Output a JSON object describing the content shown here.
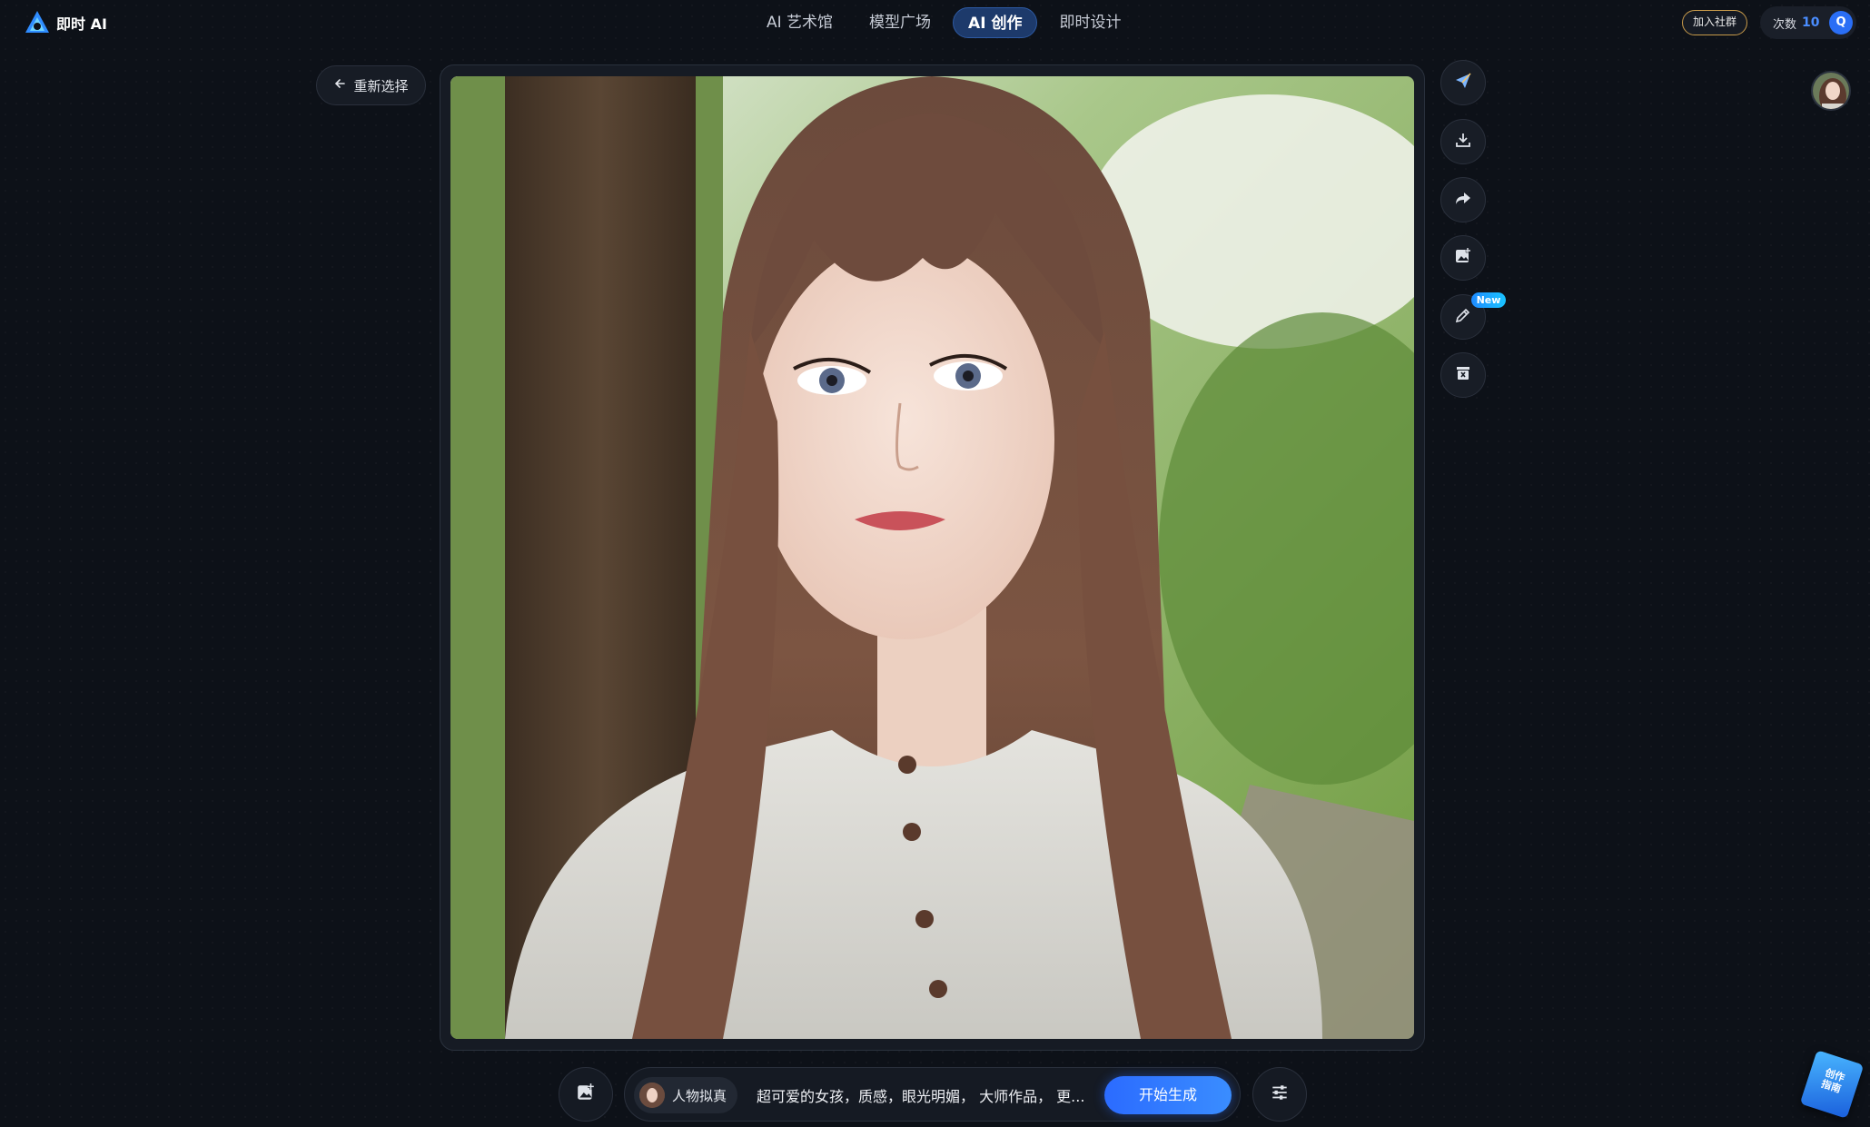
{
  "app": {
    "name": "即时 AI"
  },
  "nav": {
    "items": [
      {
        "label": "AI 艺术馆"
      },
      {
        "label": "模型广场"
      },
      {
        "label": "AI 创作"
      },
      {
        "label": "即时设计"
      }
    ],
    "active_index": 2
  },
  "header": {
    "join_label": "加入社群",
    "credits_label": "次数",
    "credits_value": "10",
    "user_initial": "Q"
  },
  "back_label": "重新选择",
  "toolbar": {
    "icons": [
      "send-icon",
      "download-icon",
      "share-icon",
      "add-image-icon",
      "edit-icon",
      "delete-icon"
    ],
    "new_badge": "New"
  },
  "prompt": {
    "style_label": "人物拟真",
    "text": "超可爱的女孩，质感，眼光明媚， 大师作品， 更...",
    "generate_label": "开始生成"
  },
  "guide": {
    "label": "创作指南"
  },
  "colors": {
    "accent": "#2b6bff",
    "background": "#0d1118",
    "active_tab": "#1d3a6b"
  }
}
